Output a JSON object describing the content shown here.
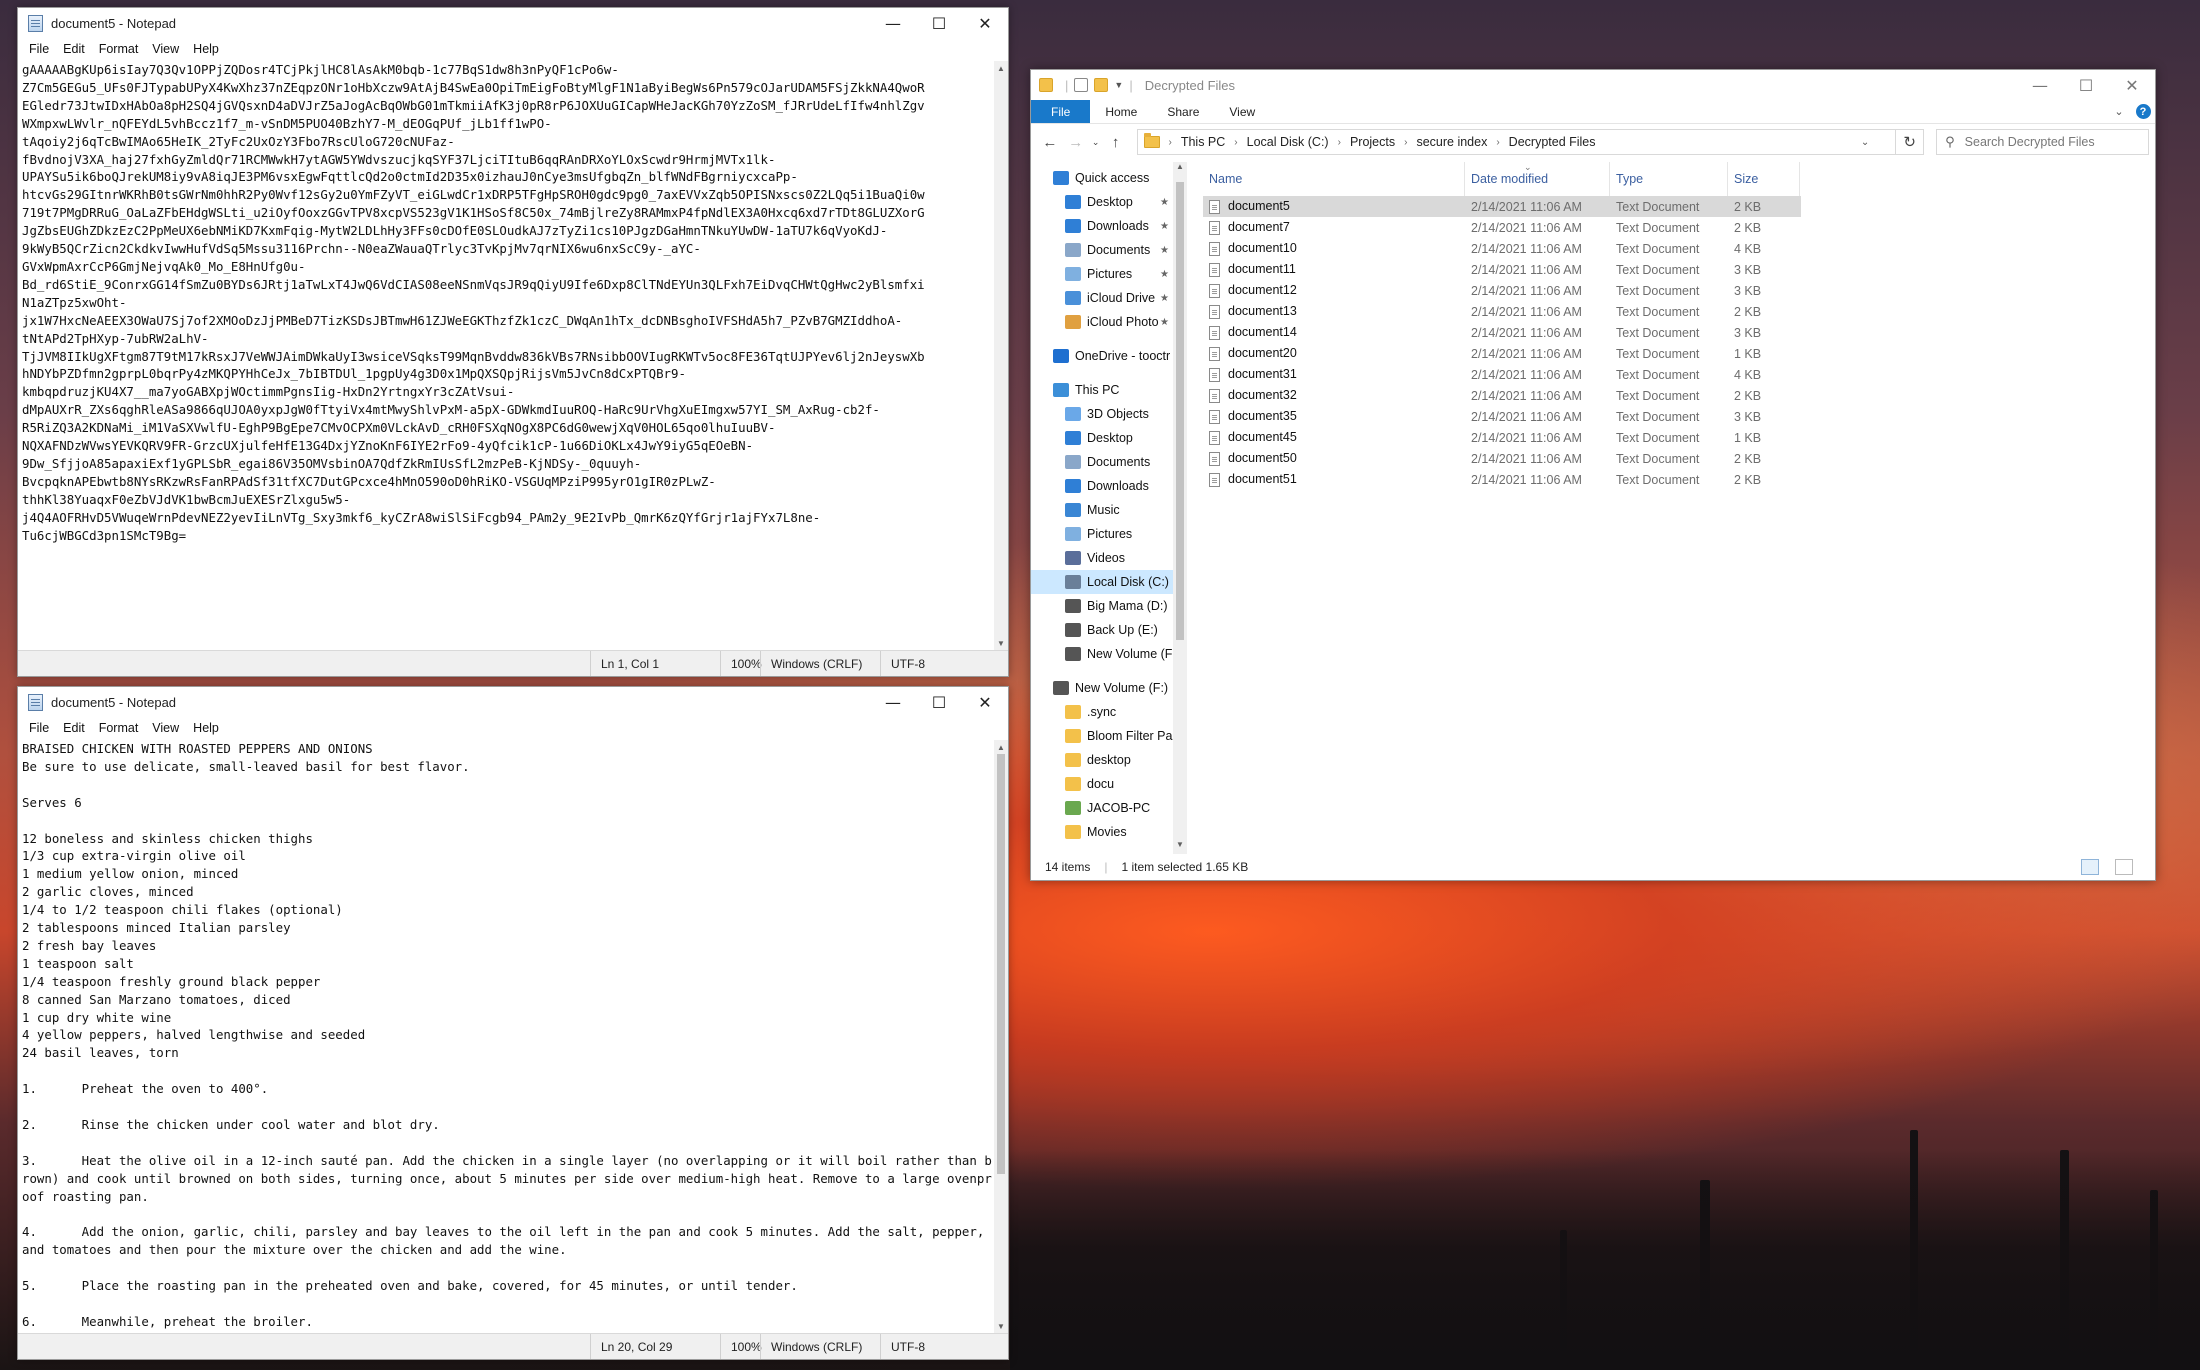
{
  "notepad_top": {
    "title": "document5 - Notepad",
    "menu": [
      "File",
      "Edit",
      "Format",
      "View",
      "Help"
    ],
    "lines": [
      "gAAAAABgKUp6isIay7Q3Qv1OPPjZQDosr4TCjPkjlHC8lAsAkM0bqb-1c77BqS1dw8h3nPyQF1cPo6w-",
      "Z7Cm5GEGu5_UFs0FJTypabUPyX4KwXhz37nZEqpzONr1oHbXczw9AtAjB4SwEa0OpiTmEigFoBtyMlgF1N1aByiBegWs6Pn579cOJarUDAM5FSjZkkNA4QwoR",
      "EGledr73JtwIDxHAbOa8pH2SQ4jGVQsxnD4aDVJrZ5aJogAcBqOWbG01mTkmiiAfK3j0pR8rP6JOXUuGICapWHeJacKGh70YzZoSM_fJRrUdeLfIfw4nhlZgv",
      "WXmpxwLWvlr_nQFEYdL5vhBccz1f7_m-vSnDM5PUO40BzhY7-M_dEOGqPUf_jLb1ff1wPO-",
      "tAqoiy2j6qTcBwIMAo65HeIK_2TyFc2UxOzY3Fbo7RscUloG720cNUFaz-",
      "fBvdnojV3XA_haj27fxhGyZmldQr71RCMWwkH7ytAGW5YWdvszucjkqSYF37LjciTItuB6qqRAnDRXoYLOxScwdr9HrmjMVTx1lk-",
      "UPAYSu5ik6boQJrekUM8iy9vA8iqJE3PM6vsxEgwFqttlcQd2o0ctmId2D35x0izhauJ0nCye3msUfgbqZn_blfWNdFBgrniycxcaPp-",
      "htcvGs29GItnrWKRhB0tsGWrNm0hhR2Py0Wvf12sGy2u0YmFZyVT_eiGLwdCr1xDRP5TFgHpSROH0gdc9pg0_7axEVVxZqb5OPISNxscs0Z2LQq5i1BuaQi0w",
      "719t7PMgDRRuG_OaLaZFbEHdgWSLti_u2iOyfOoxzGGvTPV8xcpVS523gV1K1HSoSf8C50x_74mBjlreZy8RAMmxP4fpNdlEX3A0Hxcq6xd7rTDt8GLUZXorG",
      "JgZbsEUGhZDkzEzC2PpMeUX6ebNMiKD7KxmFqig-MytW2LDLhHy3FFs0cDOfE0SLOudkAJ7zTyZi1cs10PJgzDGaHmnTNkuYUwDW-1aTU7k6qVyoKdJ-",
      "9kWyB5QCrZicn2CkdkvIwwHufVdSq5Mssu3116Prchn--N0eaZWauaQTrlyc3TvKpjMv7qrNIX6wu6nxScC9y-_aYC-",
      "GVxWpmAxrCcP6GmjNejvqAk0_Mo_E8HnUfg0u-",
      "Bd_rd6StiE_9ConrxGG14fSmZu0BYDs6JRtj1aTwLxT4JwQ6VdCIAS08eeNSnmVqsJR9qQiyU9Ife6Dxp8ClTNdEYUn3QLFxh7EiDvqCHWtQgHwc2yBlsmfxi",
      "N1aZTpz5xwOht-",
      "jx1W7HxcNeAEEX3OWaU7Sj7of2XMOoDzJjPMBeD7TizKSDsJBTmwH61ZJWeEGKThzfZk1czC_DWqAn1hTx_dcDNBsghoIVFSHdA5h7_PZvB7GMZIddhoA-",
      "tNtAPd2TpHXyp-7ubRW2aLhV-",
      "TjJVM8IIkUgXFtgm87T9tM17kRsxJ7VeWWJAimDWkaUyI3wsiceVSqksT99MqnBvddw836kVBs7RNsibbOOVIugRKWTv5oc8FE36TqtUJPYev6lj2nJeyswXb",
      "hNDYbPZDfmn2gprpL0bqrPy4zMKQPYHhCeJx_7bIBTDUl_1pgpUy4g3D0x1MpQXSQpjRijsVm5JvCn8dCxPTQBr9-",
      "kmbqpdruzjKU4X7__ma7yoGABXpjWOctimmPgnsIig-HxDn2YrtngxYr3cZAtVsui-",
      "dMpAUXrR_ZXs6qghRleASa9866qUJOA0yxpJgW0fTtyiVx4mtMwyShlvPxM-a5pX-GDWkmdIuuROQ-HaRc9UrVhgXuEImgxw57YI_SM_AxRug-cb2f-",
      "R5RiZQ3A2KDNaMi_iM1VaSXVwlfU-EghP9BgEpe7CMvOCPXm0VLckAvD_cRH0FSXqNOgX8PC6dG0wewjXqV0HOL65qo0lhuIuuBV-",
      "NQXAFNDzWVwsYEVKQRV9FR-GrzcUXjulfeHfE13G4DxjYZnoKnF6IYE2rFo9-4yQfcik1cP-1u66DiOKLx4JwY9iyG5qEOeBN-",
      "9Dw_SfjjoA85apaxiExf1yGPLSbR_egai86V35OMVsbinOA7QdfZkRmIUsSfL2mzPeB-KjNDSy-_0quuyh-",
      "BvcpqknAPEbwtb8NYsRKzwRsFanRPAdSf31tfXC7DutGPcxce4hMnO590oD0hRiKO-VSGUqMPziP995yrO1gIR0zPLwZ-",
      "thhKl38YuaqxF0eZbVJdVK1bwBcmJuEXESrZlxgu5w5-",
      "j4Q4AOFRHvD5VWuqeWrnPdevNEZ2yevIiLnVTg_Sxy3mkf6_kyCZrA8wiSlSiFcgb94_PAm2y_9E2IvPb_QmrK6zQYfGrjr1ajFYx7L8ne-",
      "Tu6cjWBGCd3pn1SMcT9Bg="
    ],
    "status": {
      "position": "Ln 1, Col 1",
      "zoom": "100%",
      "eol": "Windows (CRLF)",
      "encoding": "UTF-8"
    }
  },
  "notepad_bottom": {
    "title": "document5 - Notepad",
    "menu": [
      "File",
      "Edit",
      "Format",
      "View",
      "Help"
    ],
    "lines": [
      "BRAISED CHICKEN WITH ROASTED PEPPERS AND ONIONS",
      "Be sure to use delicate, small-leaved basil for best flavor.",
      "",
      "Serves 6",
      "",
      "12 boneless and skinless chicken thighs",
      "1/3 cup extra-virgin olive oil",
      "1 medium yellow onion, minced",
      "2 garlic cloves, minced",
      "1/4 to 1/2 teaspoon chili flakes (optional)",
      "2 tablespoons minced Italian parsley",
      "2 fresh bay leaves",
      "1 teaspoon salt",
      "1/4 teaspoon freshly ground black pepper",
      "8 canned San Marzano tomatoes, diced",
      "1 cup dry white wine",
      "4 yellow peppers, halved lengthwise and seeded",
      "24 basil leaves, torn",
      "",
      "1.      Preheat the oven to 400°.",
      "",
      "2.      Rinse the chicken under cool water and blot dry.",
      "",
      "3.      Heat the olive oil in a 12-inch sauté pan. Add the chicken in a single layer (no overlapping or it will boil rather than brown) and cook until browned on both sides, turning once, about 5 minutes per side over medium-high heat. Remove to a large ovenproof roasting pan.",
      "",
      "4.      Add the onion, garlic, chili, parsley and bay leaves to the oil left in the pan and cook 5 minutes. Add the salt, pepper, and tomatoes and then pour the mixture over the chicken and add the wine.",
      "",
      "5.      Place the roasting pan in the preheated oven and bake, covered, for 45 minutes, or until tender.",
      "",
      "6.      Meanwhile, preheat the broiler."
    ],
    "status": {
      "position": "Ln 20, Col 29",
      "zoom": "100%",
      "eol": "Windows (CRLF)",
      "encoding": "UTF-8"
    }
  },
  "explorer": {
    "title": "Decrypted Files",
    "ribbon_tabs": [
      "File",
      "Home",
      "Share",
      "View"
    ],
    "breadcrumb": [
      "This PC",
      "Local Disk (C:)",
      "Projects",
      "secure index",
      "Decrypted Files"
    ],
    "search_placeholder": "Search Decrypted Files",
    "nav": [
      {
        "label": "Quick access",
        "icon": "star-icon",
        "color": "#2f7fd6",
        "pinned": false,
        "indent": 1
      },
      {
        "label": "Desktop",
        "icon": "desktop-icon",
        "color": "#2f7fd6",
        "pinned": true,
        "indent": 2
      },
      {
        "label": "Downloads",
        "icon": "downloads-icon",
        "color": "#2f7fd6",
        "pinned": true,
        "indent": 2
      },
      {
        "label": "Documents",
        "icon": "documents-icon",
        "color": "#8aa7c9",
        "pinned": true,
        "indent": 2
      },
      {
        "label": "Pictures",
        "icon": "pictures-icon",
        "color": "#7fb0e0",
        "pinned": true,
        "indent": 2
      },
      {
        "label": "iCloud Drive",
        "icon": "icloud-icon",
        "color": "#4a90d9",
        "pinned": true,
        "indent": 2
      },
      {
        "label": "iCloud Photo",
        "icon": "icloud-photos-icon",
        "color": "#e0a040",
        "pinned": true,
        "indent": 2
      },
      {
        "label": "",
        "icon": "",
        "color": "",
        "pinned": false,
        "indent": 0
      },
      {
        "label": "OneDrive - tooctr",
        "icon": "onedrive-icon",
        "color": "#1e6fd0",
        "pinned": false,
        "indent": 1
      },
      {
        "label": "",
        "icon": "",
        "color": "",
        "pinned": false,
        "indent": 0
      },
      {
        "label": "This PC",
        "icon": "this-pc-icon",
        "color": "#3c8fd8",
        "pinned": false,
        "indent": 1
      },
      {
        "label": "3D Objects",
        "icon": "3d-objects-icon",
        "color": "#6aa8e8",
        "pinned": false,
        "indent": 2
      },
      {
        "label": "Desktop",
        "icon": "desktop-icon",
        "color": "#2f7fd6",
        "pinned": false,
        "indent": 2
      },
      {
        "label": "Documents",
        "icon": "documents-icon",
        "color": "#8aa7c9",
        "pinned": false,
        "indent": 2
      },
      {
        "label": "Downloads",
        "icon": "downloads-icon",
        "color": "#2f7fd6",
        "pinned": false,
        "indent": 2
      },
      {
        "label": "Music",
        "icon": "music-icon",
        "color": "#3a86d4",
        "pinned": false,
        "indent": 2
      },
      {
        "label": "Pictures",
        "icon": "pictures-icon",
        "color": "#7fb0e0",
        "pinned": false,
        "indent": 2
      },
      {
        "label": "Videos",
        "icon": "videos-icon",
        "color": "#5a6e9a",
        "pinned": false,
        "indent": 2
      },
      {
        "label": "Local Disk (C:)",
        "icon": "drive-icon",
        "color": "#6a7f99",
        "pinned": false,
        "indent": 2,
        "selected": true
      },
      {
        "label": "Big Mama (D:)",
        "icon": "drive-icon",
        "color": "#555555",
        "pinned": false,
        "indent": 2
      },
      {
        "label": "Back Up (E:)",
        "icon": "drive-icon",
        "color": "#555555",
        "pinned": false,
        "indent": 2
      },
      {
        "label": "New Volume (F:)",
        "icon": "drive-icon",
        "color": "#555555",
        "pinned": false,
        "indent": 2
      },
      {
        "label": "",
        "icon": "",
        "color": "",
        "pinned": false,
        "indent": 0
      },
      {
        "label": "New Volume (F:)",
        "icon": "drive-icon",
        "color": "#555555",
        "pinned": false,
        "indent": 1
      },
      {
        "label": ".sync",
        "icon": "folder-icon",
        "color": "#f3c14a",
        "pinned": false,
        "indent": 2
      },
      {
        "label": "Bloom Filter Pas",
        "icon": "folder-icon",
        "color": "#f3c14a",
        "pinned": false,
        "indent": 2
      },
      {
        "label": "desktop",
        "icon": "folder-icon",
        "color": "#f3c14a",
        "pinned": false,
        "indent": 2
      },
      {
        "label": "docu",
        "icon": "folder-icon",
        "color": "#f3c14a",
        "pinned": false,
        "indent": 2
      },
      {
        "label": "JACOB-PC",
        "icon": "network-pc-icon",
        "color": "#6aa84f",
        "pinned": false,
        "indent": 2
      },
      {
        "label": "Movies",
        "icon": "folder-icon",
        "color": "#f3c14a",
        "pinned": false,
        "indent": 2
      }
    ],
    "columns": [
      "Name",
      "Date modified",
      "Type",
      "Size"
    ],
    "files": [
      {
        "name": "document5",
        "date": "2/14/2021 11:06 AM",
        "type": "Text Document",
        "size": "2 KB",
        "selected": true
      },
      {
        "name": "document7",
        "date": "2/14/2021 11:06 AM",
        "type": "Text Document",
        "size": "2 KB"
      },
      {
        "name": "document10",
        "date": "2/14/2021 11:06 AM",
        "type": "Text Document",
        "size": "4 KB"
      },
      {
        "name": "document11",
        "date": "2/14/2021 11:06 AM",
        "type": "Text Document",
        "size": "3 KB"
      },
      {
        "name": "document12",
        "date": "2/14/2021 11:06 AM",
        "type": "Text Document",
        "size": "3 KB"
      },
      {
        "name": "document13",
        "date": "2/14/2021 11:06 AM",
        "type": "Text Document",
        "size": "2 KB"
      },
      {
        "name": "document14",
        "date": "2/14/2021 11:06 AM",
        "type": "Text Document",
        "size": "3 KB"
      },
      {
        "name": "document20",
        "date": "2/14/2021 11:06 AM",
        "type": "Text Document",
        "size": "1 KB"
      },
      {
        "name": "document31",
        "date": "2/14/2021 11:06 AM",
        "type": "Text Document",
        "size": "4 KB"
      },
      {
        "name": "document32",
        "date": "2/14/2021 11:06 AM",
        "type": "Text Document",
        "size": "2 KB"
      },
      {
        "name": "document35",
        "date": "2/14/2021 11:06 AM",
        "type": "Text Document",
        "size": "3 KB"
      },
      {
        "name": "document45",
        "date": "2/14/2021 11:06 AM",
        "type": "Text Document",
        "size": "1 KB"
      },
      {
        "name": "document50",
        "date": "2/14/2021 11:06 AM",
        "type": "Text Document",
        "size": "2 KB"
      },
      {
        "name": "document51",
        "date": "2/14/2021 11:06 AM",
        "type": "Text Document",
        "size": "2 KB"
      }
    ],
    "status": {
      "count": "14 items",
      "selection": "1 item selected  1.65 KB"
    }
  }
}
